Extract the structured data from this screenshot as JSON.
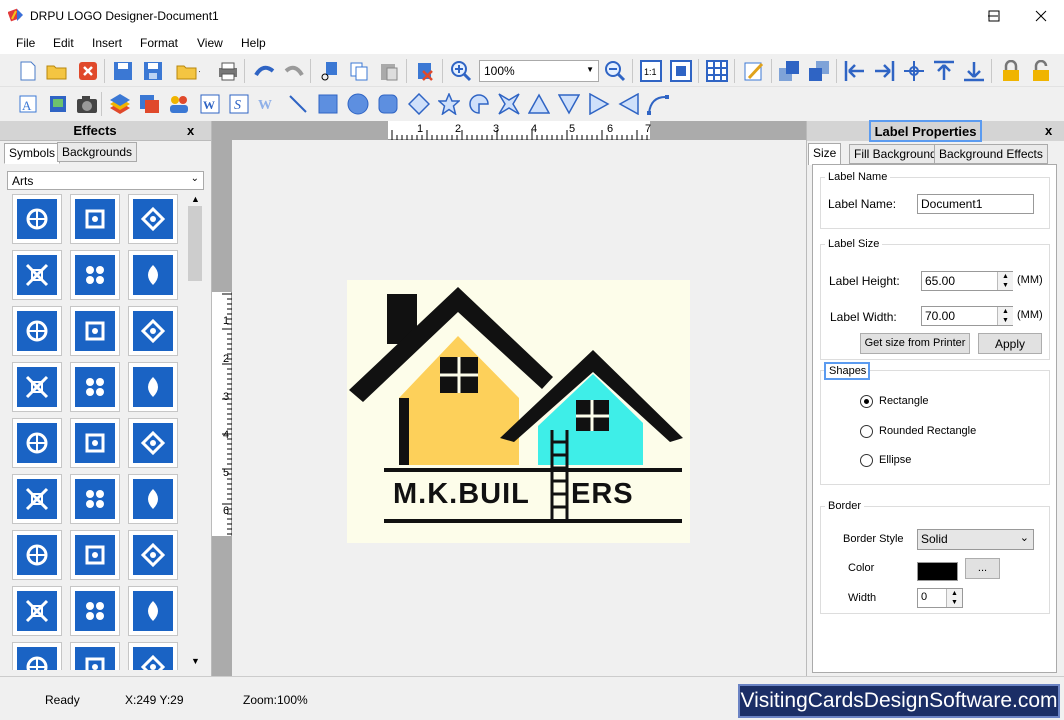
{
  "window": {
    "title": "DRPU LOGO Designer-Document1"
  },
  "menu": [
    "File",
    "Edit",
    "Insert",
    "Format",
    "View",
    "Help"
  ],
  "toolbar": {
    "zoom_value": "100%"
  },
  "left_panel": {
    "title": "Effects",
    "close": "x",
    "tabs": [
      "Symbols",
      "Backgrounds"
    ],
    "category": "Arts"
  },
  "rulers": {
    "h_ticks": [
      "1",
      "2",
      "3",
      "4",
      "5",
      "6",
      "7"
    ],
    "v_ticks": [
      "1",
      "2",
      "3",
      "4",
      "5",
      "6"
    ]
  },
  "logo": {
    "text": "M.K.BUIL",
    "text_end": "ERS",
    "colors": {
      "big_house": "#fdd05a",
      "small_house": "#3eeee8",
      "roof": "#111111"
    }
  },
  "right_panel": {
    "title": "Label Properties",
    "close": "x",
    "tabs": [
      "Size",
      "Fill Background",
      "Background Effects"
    ],
    "label_name_group": "Label Name",
    "label_name_caption": "Label Name:",
    "label_name_value": "Document1",
    "label_size_group": "Label Size",
    "height_caption": "Label Height:",
    "height_value": "65.00",
    "width_caption": "Label Width:",
    "width_value": "70.00",
    "unit": "(MM)",
    "printer_button": "Get size from Printer",
    "apply_button": "Apply",
    "shapes_group": "Shapes",
    "shapes": [
      "Rectangle",
      "Rounded Rectangle",
      "Ellipse"
    ],
    "border_group": "Border",
    "border_style_caption": "Border Style",
    "border_style_value": "Solid",
    "color_caption": "Color",
    "color_button": "...",
    "width_border_caption": "Width",
    "width_border_value": "0"
  },
  "status": {
    "ready": "Ready",
    "coords": "X:249  Y:29",
    "zoom": "Zoom:100%"
  },
  "brand": "VisitingCardsDesignSoftware.com"
}
